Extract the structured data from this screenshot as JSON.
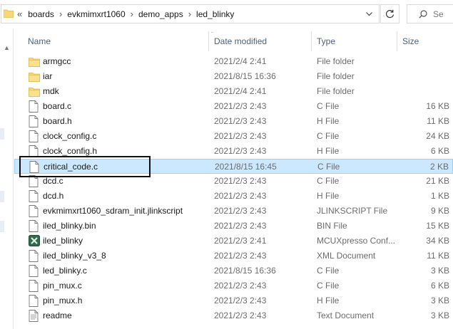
{
  "address_bar": {
    "overflow_label": "«",
    "crumbs": [
      "boards",
      "evkmimxrt1060",
      "demo_apps",
      "led_blinky"
    ],
    "separator": "›"
  },
  "search": {
    "placeholder": "Se"
  },
  "columns": {
    "name": "Name",
    "date": "Date modified",
    "type": "Type",
    "size": "Size"
  },
  "files": [
    {
      "icon": "folder-icon",
      "name": "armgcc",
      "date": "2021/2/4 2:41",
      "type": "File folder",
      "size": ""
    },
    {
      "icon": "folder-icon",
      "name": "iar",
      "date": "2021/8/15 16:36",
      "type": "File folder",
      "size": ""
    },
    {
      "icon": "folder-icon",
      "name": "mdk",
      "date": "2021/2/4 2:41",
      "type": "File folder",
      "size": ""
    },
    {
      "icon": "file-icon",
      "name": "board.c",
      "date": "2021/2/3 2:43",
      "type": "C File",
      "size": "16 KB"
    },
    {
      "icon": "file-icon",
      "name": "board.h",
      "date": "2021/2/3 2:43",
      "type": "H File",
      "size": "11 KB"
    },
    {
      "icon": "file-icon",
      "name": "clock_config.c",
      "date": "2021/2/3 2:43",
      "type": "C File",
      "size": "24 KB"
    },
    {
      "icon": "file-icon",
      "name": "clock_config.h",
      "date": "2021/2/3 2:43",
      "type": "H File",
      "size": "6 KB"
    },
    {
      "icon": "file-icon",
      "name": "critical_code.c",
      "date": "2021/8/15 16:45",
      "type": "C File",
      "size": "2 KB",
      "selected": true
    },
    {
      "icon": "file-icon",
      "name": "dcd.c",
      "date": "2021/2/3 2:43",
      "type": "C File",
      "size": "21 KB"
    },
    {
      "icon": "file-icon",
      "name": "dcd.h",
      "date": "2021/2/3 2:43",
      "type": "H File",
      "size": "1 KB"
    },
    {
      "icon": "file-icon",
      "name": "evkmimxrt1060_sdram_init.jlinkscript",
      "date": "2021/2/3 2:43",
      "type": "JLINKSCRIPT File",
      "size": "9 KB"
    },
    {
      "icon": "file-icon",
      "name": "iled_blinky.bin",
      "date": "2021/2/3 2:43",
      "type": "BIN File",
      "size": "15 KB"
    },
    {
      "icon": "mcuxpresso-icon",
      "name": "iled_blinky",
      "date": "2021/2/3 2:41",
      "type": "MCUXpresso Conf...",
      "size": "34 KB"
    },
    {
      "icon": "file-icon",
      "name": "iled_blinky_v3_8",
      "date": "2021/2/3 2:43",
      "type": "XML Document",
      "size": "11 KB"
    },
    {
      "icon": "file-icon",
      "name": "led_blinky.c",
      "date": "2021/8/15 16:36",
      "type": "C File",
      "size": "3 KB"
    },
    {
      "icon": "file-icon",
      "name": "pin_mux.c",
      "date": "2021/2/3 2:43",
      "type": "C File",
      "size": "6 KB"
    },
    {
      "icon": "file-icon",
      "name": "pin_mux.h",
      "date": "2021/2/3 2:43",
      "type": "H File",
      "size": "3 KB"
    },
    {
      "icon": "text-doc-icon",
      "name": "readme",
      "date": "2021/2/3 2:43",
      "type": "Text Document",
      "size": "3 KB"
    }
  ],
  "colors": {
    "folder": "#f8d775",
    "selection": "#cce8ff",
    "selection_border": "#99d1ff",
    "header_text": "#4c607a"
  }
}
